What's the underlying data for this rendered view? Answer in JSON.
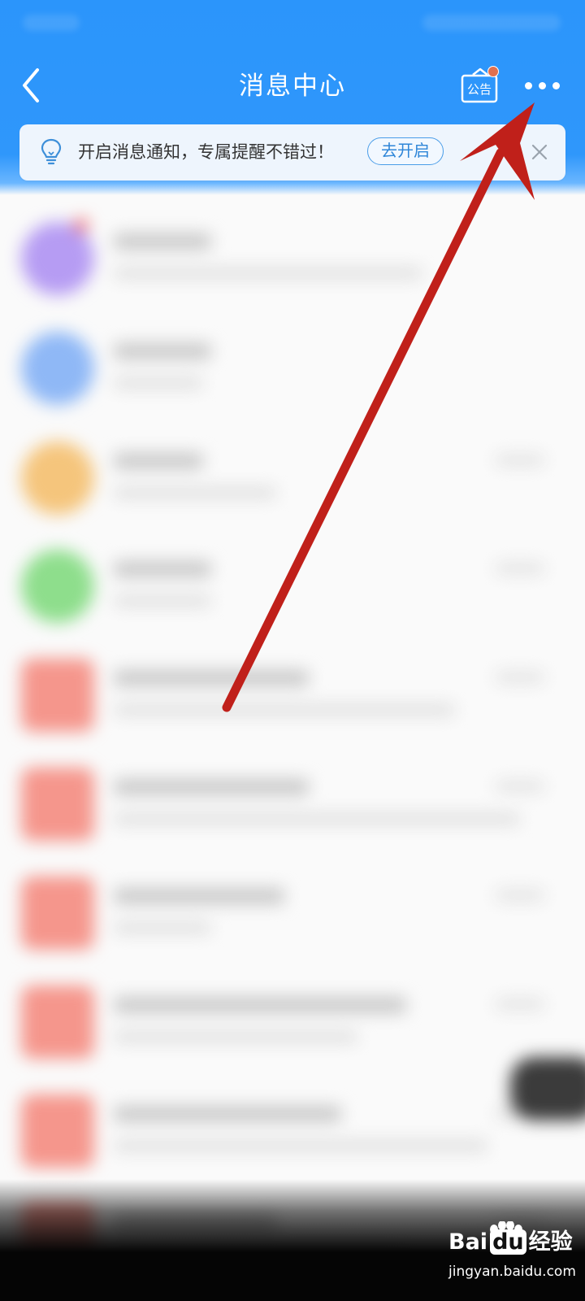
{
  "header": {
    "title": "消息中心",
    "back_icon": "chevron-left-icon",
    "notice_label": "公告",
    "more_icon": "more-horizontal-icon"
  },
  "banner": {
    "text": "开启消息通知，专属提醒不错过！",
    "button_label": "去开启",
    "bulb_icon": "lightbulb-icon",
    "close_icon": "close-icon"
  },
  "message_list": {
    "items": [
      {
        "avatar_color": "#b69cf3",
        "shape": "round",
        "unread": true
      },
      {
        "avatar_color": "#8fb8f6",
        "shape": "round",
        "unread": false
      },
      {
        "avatar_color": "#f5c57c",
        "shape": "round",
        "unread": false
      },
      {
        "avatar_color": "#8ede8c",
        "shape": "round",
        "unread": false
      },
      {
        "avatar_color": "#f5968c",
        "shape": "square",
        "unread": false
      },
      {
        "avatar_color": "#f5968c",
        "shape": "square",
        "unread": false
      },
      {
        "avatar_color": "#f5968c",
        "shape": "square",
        "unread": false
      },
      {
        "avatar_color": "#f5968c",
        "shape": "square",
        "unread": false
      },
      {
        "avatar_color": "#f5968c",
        "shape": "square",
        "unread": false
      },
      {
        "avatar_color": "#f5968c",
        "shape": "square",
        "unread": false
      }
    ]
  },
  "watermark": {
    "brand_left": "Bai",
    "brand_middle": "du",
    "brand_right": "经验",
    "url": "jingyan.baidu.com"
  },
  "colors": {
    "header_blue": "#2f97fb",
    "annotation_arrow": "#c0201a",
    "banner_bg": "#eef5fd",
    "button_blue": "#2f86d8"
  }
}
